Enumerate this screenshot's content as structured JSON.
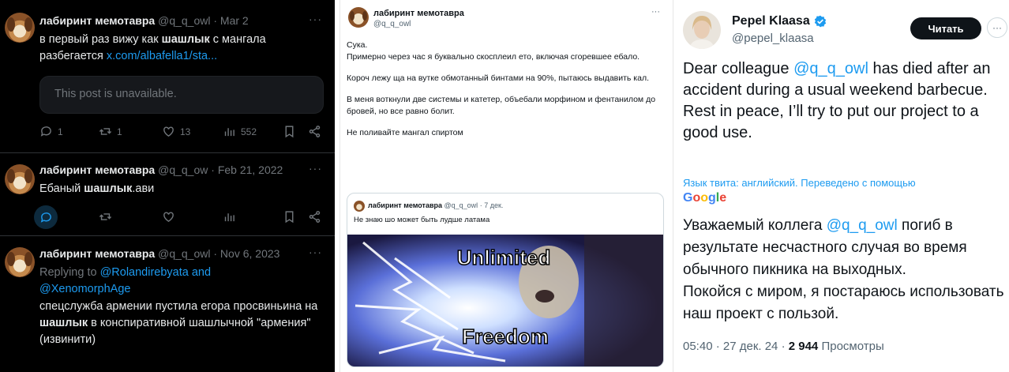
{
  "panel1": {
    "tweets": [
      {
        "name": "лабиринт мемотавра",
        "handle": "@q_q_owl",
        "date": "· Mar 2",
        "text_pre": "в первый раз вижу как ",
        "text_bold": "шашлык",
        "text_post": " с мангала разбегается ",
        "link": "x.com/albafella1/sta...",
        "unavailable": "This post is unavailable.",
        "replies": "1",
        "reposts": "1",
        "likes": "13",
        "views": "552"
      },
      {
        "name": "лабиринт мемотавра",
        "handle": "@q_q_ow",
        "date": "· Feb 21, 2022",
        "text_pre": "Ебаный ",
        "text_bold": "шашлык",
        "text_post": ".ави"
      },
      {
        "name": "лабиринт мемотавра",
        "handle": "@q_q_owl",
        "date": "· Nov 6, 2023",
        "replying_prefix": "Replying to ",
        "replying_1": "@Rolandirebyata",
        "replying_and": " and",
        "replying_2": "@XenomorphAge",
        "text_pre": "спецслужба армении пустила егора просвиньина на ",
        "text_bold": "шашлык",
        "text_post": " в конспиративной шашлычной \"армения\"",
        "text_line": "(извинити)"
      }
    ]
  },
  "panel2": {
    "name": "лабиринт мемотавра",
    "handle": "@q_q_owl",
    "paragraphs": [
      "Сука.",
      "Примерно через час я буквально скосплеил ето, включая сгоревшее ебало.",
      "",
      "Короч лежу ща на вутке обмотанный бинтами на 90%, пытаюсь выдавить кал.",
      "",
      "В меня воткнули две системы и катетер, объебали морфином и фентанилом до бровей, но все равно болит.",
      "",
      "Не поливайте мангал спиртом"
    ],
    "quote": {
      "name": "лабиринт мемотавра",
      "handle": "@q_q_owl",
      "date": "· 7 дек.",
      "text": "Не знаю шо может быть лудше латама",
      "meme_top": "Unlimited",
      "meme_bottom": "Freedom"
    }
  },
  "panel3": {
    "name": "Pepel Klaasa",
    "handle": "@pepel_klaasa",
    "follow": "Читать",
    "text_pre": "Dear colleague ",
    "mention": "@q_q_owl",
    "text_post": " has died after an accident during a usual weekend barbecue.",
    "text_line2": "Rest in peace, I’ll try to put our project to a good use.",
    "translated": "Язык твита: английский. Переведено с помощью",
    "google": [
      "G",
      "o",
      "o",
      "g",
      "l",
      "e"
    ],
    "ru_pre": "Уважаемый коллега ",
    "ru_mention": "@q_q_owl",
    "ru_post": " погиб в результате несчастного случая во время обычного пикника на выходных.",
    "ru_line2": "Покойся с миром, я постараюсь использовать наш проект с пользой.",
    "time": "05:40 · 27 дек. 24 · ",
    "views": "2 944",
    "views_label": " Просмотры"
  }
}
